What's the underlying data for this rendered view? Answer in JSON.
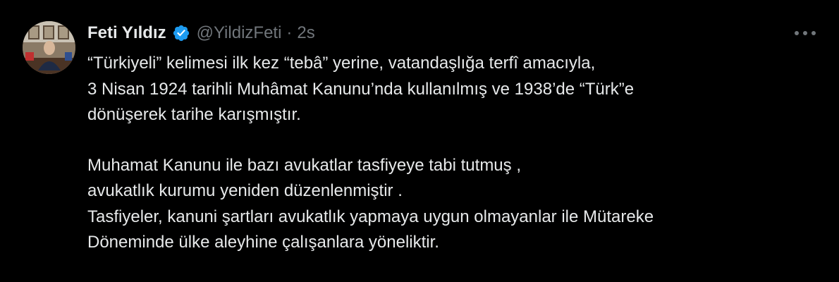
{
  "tweet": {
    "author": {
      "display_name": "Feti Yıldız",
      "handle": "@YildizFeti",
      "verified_icon": "verified-badge-icon",
      "avatar": "profile-photo"
    },
    "separator": "·",
    "time": "2s",
    "more_icon": "more-horizontal-icon",
    "paragraphs": [
      {
        "lines": [
          "“Türkiyeli” kelimesi ilk kez “tebâ” yerine, vatandaşlığa terfî amacıyla,",
          "3 Nisan 1924 tarihli Muhâmat Kanunu’nda kullanılmış ve 1938’de “Türk”e",
          "dönüşerek tarihe karışmıştır."
        ]
      },
      {
        "lines": [
          "Muhamat Kanunu ile bazı avukatlar tasfiyeye tabi tutmuş ,",
          "avukatlık kurumu yeniden düzenlenmiştir .",
          "Tasfiyeler, kanuni şartları avukatlık yapmaya uygun olmayanlar ile Mütareke",
          "Döneminde ülke aleyhine çalışanlara yöneliktir."
        ]
      }
    ],
    "colors": {
      "background": "#000000",
      "text": "#e7e9ea",
      "secondary": "#71767b",
      "verified": "#1d9bf0"
    }
  }
}
